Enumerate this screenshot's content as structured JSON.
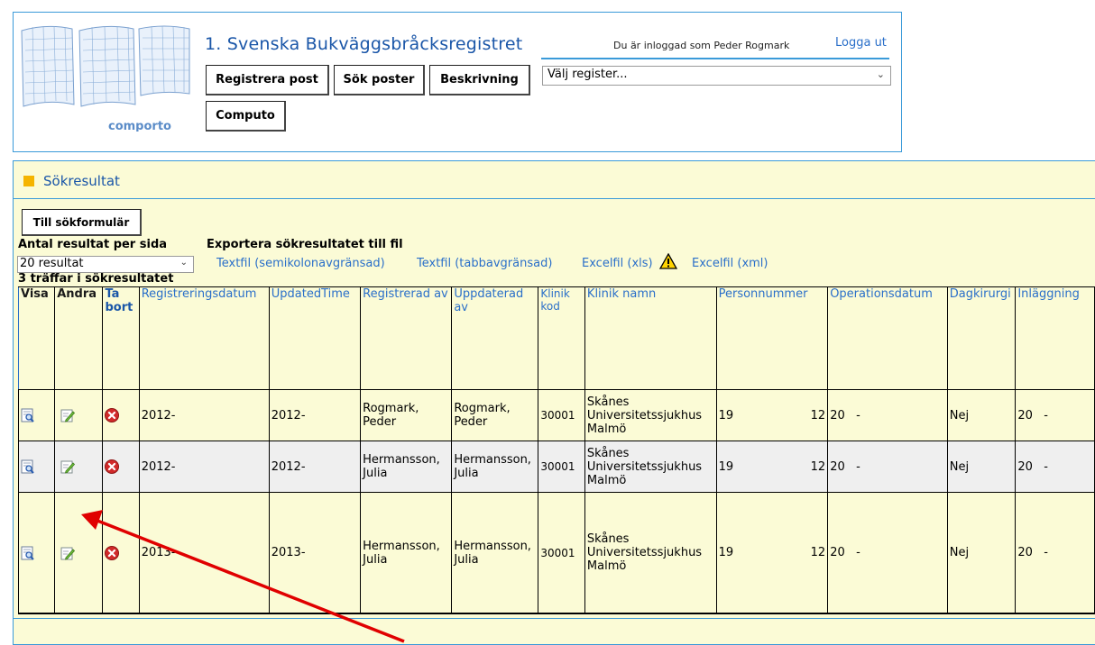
{
  "header": {
    "title": "1. Svenska Bukväggsbråcksregistret",
    "login_text": "Du är inloggad som Peder Rogmark",
    "logout_label": "Logga ut",
    "logo_text": "comporto",
    "buttons": {
      "registrera": "Registrera post",
      "sok": "Sök poster",
      "beskrivning": "Beskrivning",
      "computo": "Computo"
    },
    "register_select": "Välj register..."
  },
  "panel": {
    "title": "Sökresultat",
    "back_button": "Till sökformulär",
    "per_page_label": "Antal resultat per sida",
    "per_page_value": "20 resultat",
    "export_label": "Exportera sökresultatet till fil",
    "export_links": [
      "Textfil (semikolonavgränsad)",
      "Textfil (tabbavgränsad)",
      "Excelfil (xls)",
      "Excelfil (xml)"
    ],
    "hits": "3 träffar i sökresultatet"
  },
  "table": {
    "headers": [
      "Visa",
      "Ändra",
      "Ta bort",
      "Registreringsdatum",
      "UpdatedTime",
      "Registrerad av",
      "Uppdaterad av",
      "Klinik kod",
      "Klinik namn",
      "Personnummer",
      "Operationsdatum",
      "Dagkirurgi",
      "Inläggning"
    ],
    "rows": [
      {
        "reg_date": "2012-",
        "updated": "2012-",
        "reg_by": "Rogmark, Peder",
        "upd_by": "Rogmark, Peder",
        "klinik_kod": "30001",
        "klinik_namn": "Skånes Universitetssjukhus Malmö",
        "pnr_a": "19",
        "pnr_b": "12",
        "op_date": "20   -",
        "dagkirurgi": "Nej",
        "inlaggning": "20   -"
      },
      {
        "reg_date": "2012-",
        "updated": "2012-",
        "reg_by": "Hermansson, Julia",
        "upd_by": "Hermansson, Julia",
        "klinik_kod": "30001",
        "klinik_namn": "Skånes Universitetssjukhus Malmö",
        "pnr_a": "19",
        "pnr_b": "12",
        "op_date": "20   -",
        "dagkirurgi": "Nej",
        "inlaggning": "20   -"
      },
      {
        "reg_date": "2013-",
        "updated": "2013-",
        "reg_by": "Hermansson, Julia",
        "upd_by": "Hermansson, Julia",
        "klinik_kod": "30001",
        "klinik_namn": "Skånes Universitetssjukhus Malmö",
        "pnr_a": "19",
        "pnr_b": "12",
        "op_date": "20   -",
        "dagkirurgi": "Nej",
        "inlaggning": "20   -"
      }
    ]
  },
  "icons": {
    "view": "view-record-icon",
    "edit": "edit-record-icon",
    "delete": "delete-record-icon",
    "warning": "warning-icon",
    "annotation": "red-arrow-annotation"
  },
  "colors": {
    "accent_blue": "#3a9ad9",
    "link_blue": "#2a6fc9",
    "panel_yellow": "#fbfbd6",
    "marker_orange": "#f5b400",
    "delete_red": "#d12a2a",
    "annotation_red": "#e00000"
  }
}
